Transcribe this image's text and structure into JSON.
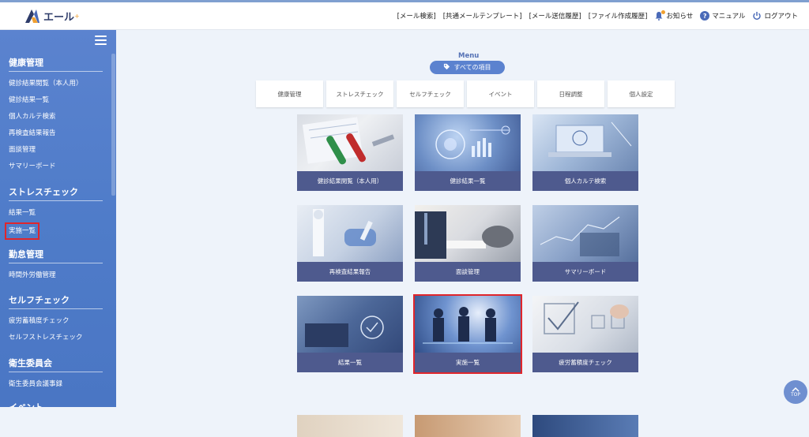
{
  "app": {
    "logo_text": "エール",
    "logo_sup": "+"
  },
  "header": {
    "links": [
      "[メール検索]",
      "[共通メールテンプレート]",
      "[メール送信履歴]",
      "[ファイル作成履歴]"
    ],
    "notice": "お知らせ",
    "manual": "マニュアル",
    "logout": "ログアウト"
  },
  "sidebar": {
    "sections": [
      {
        "title": "健康管理",
        "items": [
          "健診結果閲覧（本人用）",
          "健診結果一覧",
          "個人カルテ検索",
          "再検査結果報告",
          "面談管理",
          "サマリーボード"
        ]
      },
      {
        "title": "ストレスチェック",
        "items": [
          "結果一覧",
          "実施一覧"
        ]
      },
      {
        "title": "勤怠管理",
        "items": [
          "時間外労働管理"
        ]
      },
      {
        "title": "セルフチェック",
        "items": [
          "疲労蓄積度チェック",
          "セルフストレスチェック"
        ]
      },
      {
        "title": "衛生委員会",
        "items": [
          "衛生委員会議事録"
        ]
      },
      {
        "title": "イベント",
        "items": []
      }
    ],
    "highlighted_item": "実施一覧"
  },
  "main": {
    "menu_label": "Menu",
    "all_items_label": "すべての項目",
    "tabs": [
      "健康管理",
      "ストレスチェック",
      "セルフチェック",
      "イベント",
      "日程調整",
      "個人設定"
    ],
    "cards": [
      {
        "label": "健診結果閲覧（本人用）"
      },
      {
        "label": "健診結果一覧"
      },
      {
        "label": "個人カルテ検索"
      },
      {
        "label": "再検査結果報告"
      },
      {
        "label": "面談管理"
      },
      {
        "label": "サマリーボード"
      },
      {
        "label": "結果一覧"
      },
      {
        "label": "実施一覧"
      },
      {
        "label": "疲労蓄積度チェック"
      }
    ],
    "selected_card": "実施一覧",
    "to_top_label": "TOP"
  },
  "colors": {
    "sidebar": "#5b83cf",
    "caption": "#4e5a8e",
    "highlight": "#e0262c",
    "pill": "#5b82cf"
  }
}
